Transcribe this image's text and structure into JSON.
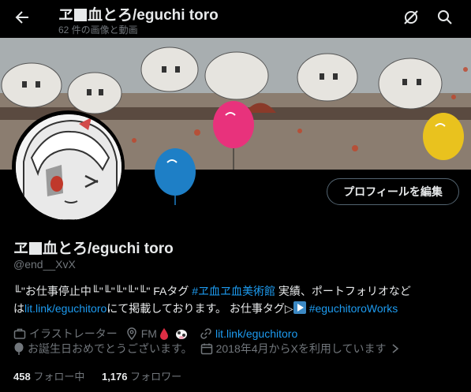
{
  "header": {
    "title_pre": "ヱ",
    "title_post": "血とろ/eguchi toro",
    "subtitle": "62 件の画像と動画"
  },
  "profile": {
    "edit_button": "プロフィールを編集",
    "name_pre": "ヱ",
    "name_post": "血とろ/eguchi toro",
    "handle": "@end__XvX"
  },
  "bio": {
    "prefix": "╙\"お仕事停止中╙\"╙\"╙\"╙\"╙\" FAタグ ",
    "hashtag1": "#ヱ血ヱ血美術館",
    "mid1": " 実績、ポートフォリオなど",
    "mid2": "は",
    "link1": "lit.link/eguchitoro",
    "mid3": "にて掲載しております。 お仕事タグ▷",
    "hashtag2": "#eguchitoroWorks"
  },
  "meta": {
    "job": "イラストレーター",
    "location": "FM",
    "website": "lit.link/eguchitoro",
    "birthday": "お誕生日おめでとうございます。",
    "joined": "2018年4月からXを利用しています"
  },
  "follow": {
    "following_count": "458",
    "following_label": "フォロー中",
    "followers_count": "1,176",
    "followers_label": "フォロワー"
  },
  "colors": {
    "link": "#1d9bf0",
    "muted": "#71767b",
    "balloon_pink": "#e8327c",
    "balloon_blue": "#1e7fc6",
    "balloon_yellow": "#e9c21e"
  }
}
